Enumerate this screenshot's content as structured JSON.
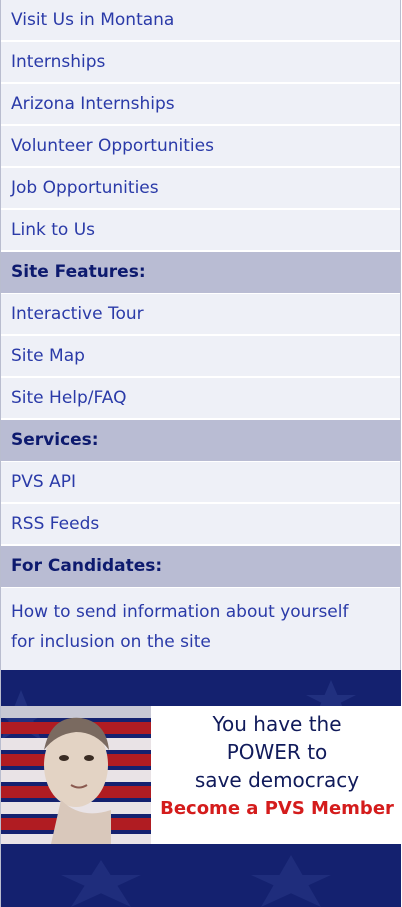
{
  "nav": {
    "about_links": [
      "Visit Us in Montana",
      "Internships",
      "Arizona Internships",
      "Volunteer Opportunities",
      "Job Opportunities",
      "Link to Us"
    ],
    "site_features": {
      "header": "Site Features:",
      "links": [
        "Interactive Tour",
        "Site Map",
        "Site Help/FAQ"
      ]
    },
    "services": {
      "header": "Services:",
      "links": [
        "PVS API",
        "RSS Feeds"
      ]
    },
    "for_candidates": {
      "header": "For Candidates:",
      "links": [
        "How to send information about yourself for inclusion on the site"
      ]
    }
  },
  "banner": {
    "line1": "You have the",
    "line2": "POWER to",
    "line3": "save democracy",
    "cta": "Become a PVS Member"
  },
  "colors": {
    "link": "#2a3aa8",
    "header_bg": "#b9bcd3",
    "header_text": "#0d1a6e",
    "banner_bg": "#14216f",
    "cta": "#d41c1c"
  }
}
